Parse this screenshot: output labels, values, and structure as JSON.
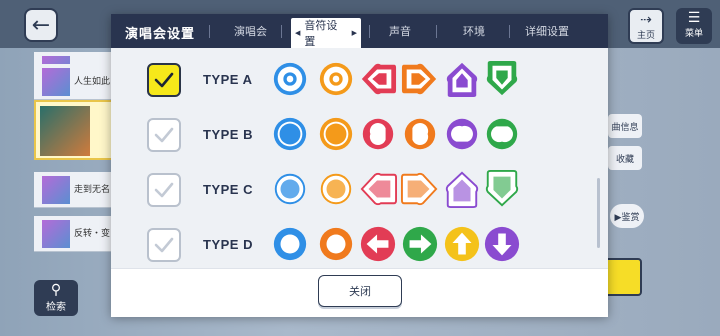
{
  "dialog": {
    "title": "演唱会设置",
    "tabs": [
      "演唱会",
      "音符设置",
      "声音",
      "环境",
      "详细设置"
    ],
    "active_tab": "音符设置",
    "close_label": "关闭",
    "rows": [
      {
        "label": "TYPE A",
        "checked": true
      },
      {
        "label": "TYPE B",
        "checked": false
      },
      {
        "label": "TYPE C",
        "checked": false
      },
      {
        "label": "TYPE D",
        "checked": false
      }
    ]
  },
  "background": {
    "home_label": "主页",
    "menu_label": "菜单",
    "search_label": "检索",
    "song_info_label": "曲信息",
    "favorite_label": "收藏",
    "appreciate_label": "▶鉴赏",
    "songs": [
      "人生如此",
      "走到无名",
      "反转・变"
    ]
  },
  "colors": {
    "blue": "#2f8fe6",
    "orange": "#f49a1a",
    "red": "#e23c55",
    "orange2": "#f07a1d",
    "purple": "#8a4bd0",
    "green": "#2fa84a",
    "header": "#29344f",
    "check_on": "#f6e81a"
  }
}
